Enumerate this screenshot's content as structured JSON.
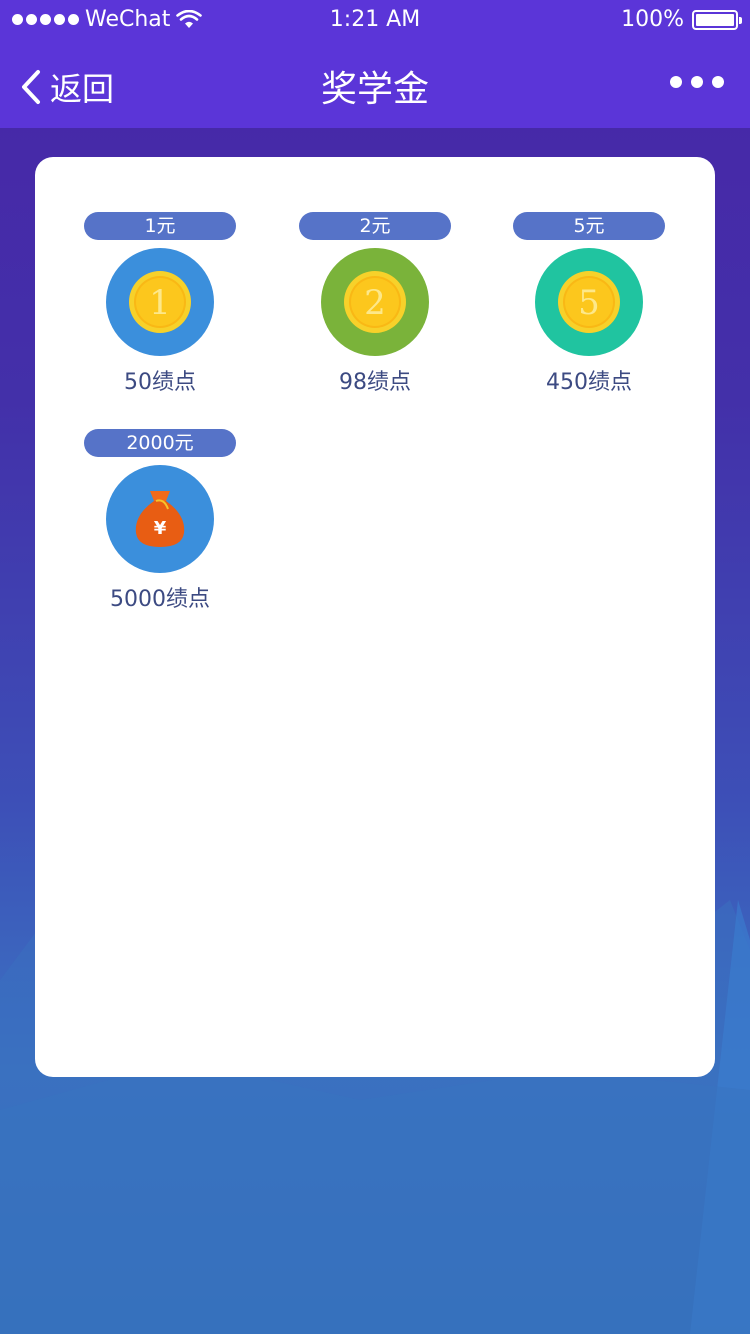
{
  "status_bar": {
    "carrier": "WeChat",
    "time": "1:21 AM",
    "battery": "100%"
  },
  "nav": {
    "back_label": "返回",
    "title": "奖学金"
  },
  "rewards": [
    {
      "amount": "1元",
      "points": "50绩点",
      "coin_text": "1",
      "circle_color": "#3b8fdc"
    },
    {
      "amount": "2元",
      "points": "98绩点",
      "coin_text": "2",
      "circle_color": "#7ab33a"
    },
    {
      "amount": "5元",
      "points": "450绩点",
      "coin_text": "5",
      "circle_color": "#20c4a0"
    },
    {
      "amount": "2000元",
      "points": "5000绩点",
      "bag_symbol": "¥",
      "circle_color": "#3b8fdc"
    }
  ],
  "colors": {
    "header": "#5b35d8",
    "pill": "#5673c8",
    "points_text": "#3c4a82"
  }
}
